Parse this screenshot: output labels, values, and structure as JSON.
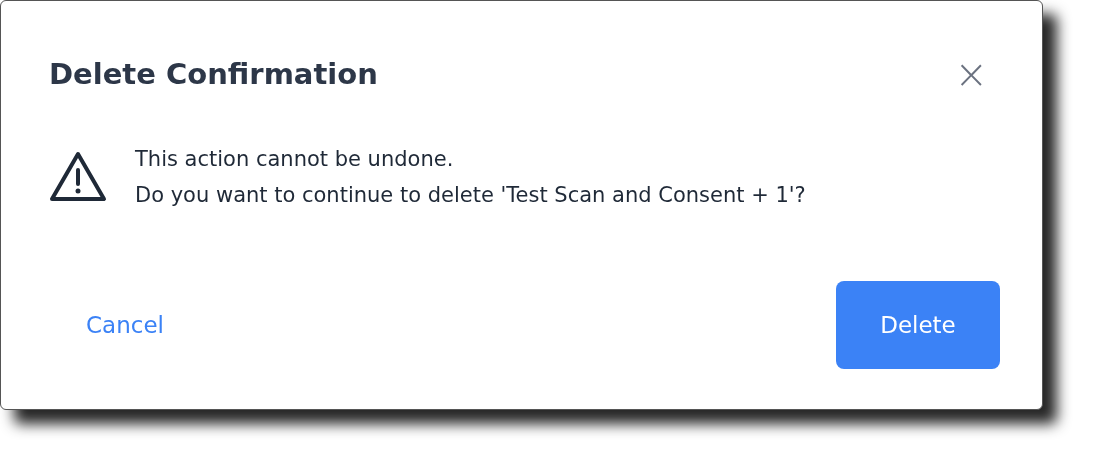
{
  "dialog": {
    "title": "Delete Confirmation",
    "close": "×",
    "message": [
      "This action cannot be undone.",
      "Do you want to continue to delete 'Test Scan and Consent + 1'?"
    ],
    "buttons": [
      {
        "label": "Cancel",
        "kind": "link"
      },
      {
        "label": "Delete",
        "kind": "primary"
      }
    ]
  }
}
